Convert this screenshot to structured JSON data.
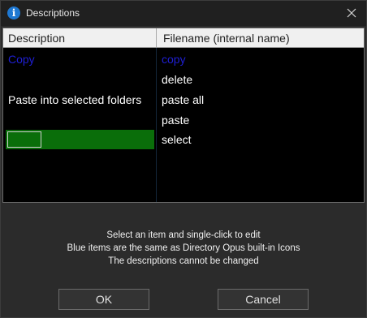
{
  "window": {
    "title": "Descriptions",
    "title_icon": "info-icon",
    "close_icon": "close-icon"
  },
  "list": {
    "columns": [
      "Description",
      "Filename (internal name)"
    ],
    "rows": [
      {
        "description": "Copy",
        "filename": "copy",
        "color": "blue",
        "selected": false
      },
      {
        "description": "",
        "filename": "delete",
        "color": "white",
        "selected": false
      },
      {
        "description": "Paste into selected folders",
        "filename": "paste all",
        "color": "white",
        "selected": false
      },
      {
        "description": "",
        "filename": "paste",
        "color": "white",
        "selected": false
      },
      {
        "description": "",
        "filename": "select",
        "color": "white",
        "selected": true
      }
    ]
  },
  "info": {
    "line1": "Select an item and single-click to edit",
    "line2": "Blue items are the same as Directory Opus built-in Icons",
    "line3": "The descriptions cannot be changed"
  },
  "buttons": {
    "ok": "OK",
    "cancel": "Cancel"
  },
  "colors": {
    "blue_item": "#1f1fd6",
    "selection": "#0a6e0a",
    "list_bg": "#000000",
    "dialog_bg": "#2b2b2b"
  }
}
